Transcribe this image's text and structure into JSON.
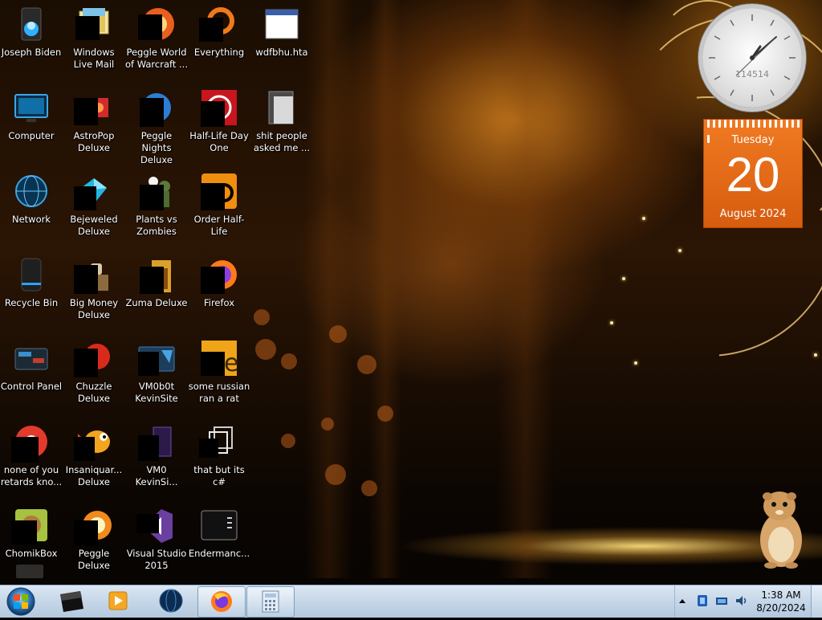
{
  "desktop": {
    "icons": [
      {
        "label": "Joseph Biden",
        "icon": "user-folder-icon"
      },
      {
        "label": "Windows Live Mail",
        "icon": "mail-icon"
      },
      {
        "label": "Peggle World of Warcraft ...",
        "icon": "peggle-icon"
      },
      {
        "label": "Everything",
        "icon": "search-app-icon"
      },
      {
        "label": "wdfbhu.hta",
        "icon": "window-file-icon"
      },
      {
        "label": "Computer",
        "icon": "computer-icon"
      },
      {
        "label": "AstroPop Deluxe",
        "icon": "astropop-icon"
      },
      {
        "label": "Peggle Nights Deluxe",
        "icon": "peggle-nights-icon"
      },
      {
        "label": "Half-Life Day One",
        "icon": "half-life-icon"
      },
      {
        "label": "shit people asked me ...",
        "icon": "folder-icon"
      },
      {
        "label": "Network",
        "icon": "network-icon"
      },
      {
        "label": "Bejeweled Deluxe",
        "icon": "bejeweled-icon"
      },
      {
        "label": "Plants vs Zombies",
        "icon": "plants-vs-zombies-icon"
      },
      {
        "label": "Order Half-Life",
        "icon": "order-icon"
      },
      {
        "label": "Recycle Bin",
        "icon": "recycle-bin-icon"
      },
      {
        "label": "Big Money Deluxe",
        "icon": "big-money-icon"
      },
      {
        "label": "Zuma Deluxe",
        "icon": "zuma-icon"
      },
      {
        "label": "Firefox",
        "icon": "firefox-icon"
      },
      {
        "label": "Control Panel",
        "icon": "control-panel-icon"
      },
      {
        "label": "Chuzzle Deluxe",
        "icon": "chuzzle-icon"
      },
      {
        "label": "VM0b0t KevinSite",
        "icon": "vm-icon"
      },
      {
        "label": "some russian ran a rat",
        "icon": "ie-icon"
      },
      {
        "label": "none of you retards kno...",
        "icon": "chrome-icon"
      },
      {
        "label": "Insaniquar... Deluxe",
        "icon": "fish-icon"
      },
      {
        "label": "VM0 KevinSi...",
        "icon": "document-icon"
      },
      {
        "label": "that but its c#",
        "icon": "copy-icon"
      },
      {
        "label": "ChomikBox",
        "icon": "hamster-app-icon"
      },
      {
        "label": "Peggle Deluxe",
        "icon": "peggle-deluxe-icon"
      },
      {
        "label": "Visual Studio 2015",
        "icon": "visual-studio-icon"
      },
      {
        "label": "Endermanc...",
        "icon": "terminal-icon"
      }
    ]
  },
  "gadgets": {
    "clock": {
      "text": "114514",
      "time": "1:38"
    },
    "calendar": {
      "weekday": "Tuesday",
      "day": "20",
      "month_year": "August 2024"
    }
  },
  "taskbar": {
    "buttons": [
      {
        "name": "start-button",
        "icon": "windows-orb-icon"
      },
      {
        "name": "taskbar-app-1",
        "icon": "black-app-icon"
      },
      {
        "name": "taskbar-media-player",
        "icon": "media-player-icon"
      },
      {
        "name": "taskbar-globe",
        "icon": "globe-icon"
      },
      {
        "name": "taskbar-firefox",
        "icon": "firefox-icon"
      },
      {
        "name": "taskbar-calculator",
        "icon": "calculator-icon"
      }
    ],
    "clock": {
      "time": "1:38 AM",
      "date": "8/20/2024"
    }
  },
  "colors": {
    "taskbar": "#c5d6e8",
    "calendar": "#e8691a",
    "wallpaper_accent": "#d6821e"
  }
}
